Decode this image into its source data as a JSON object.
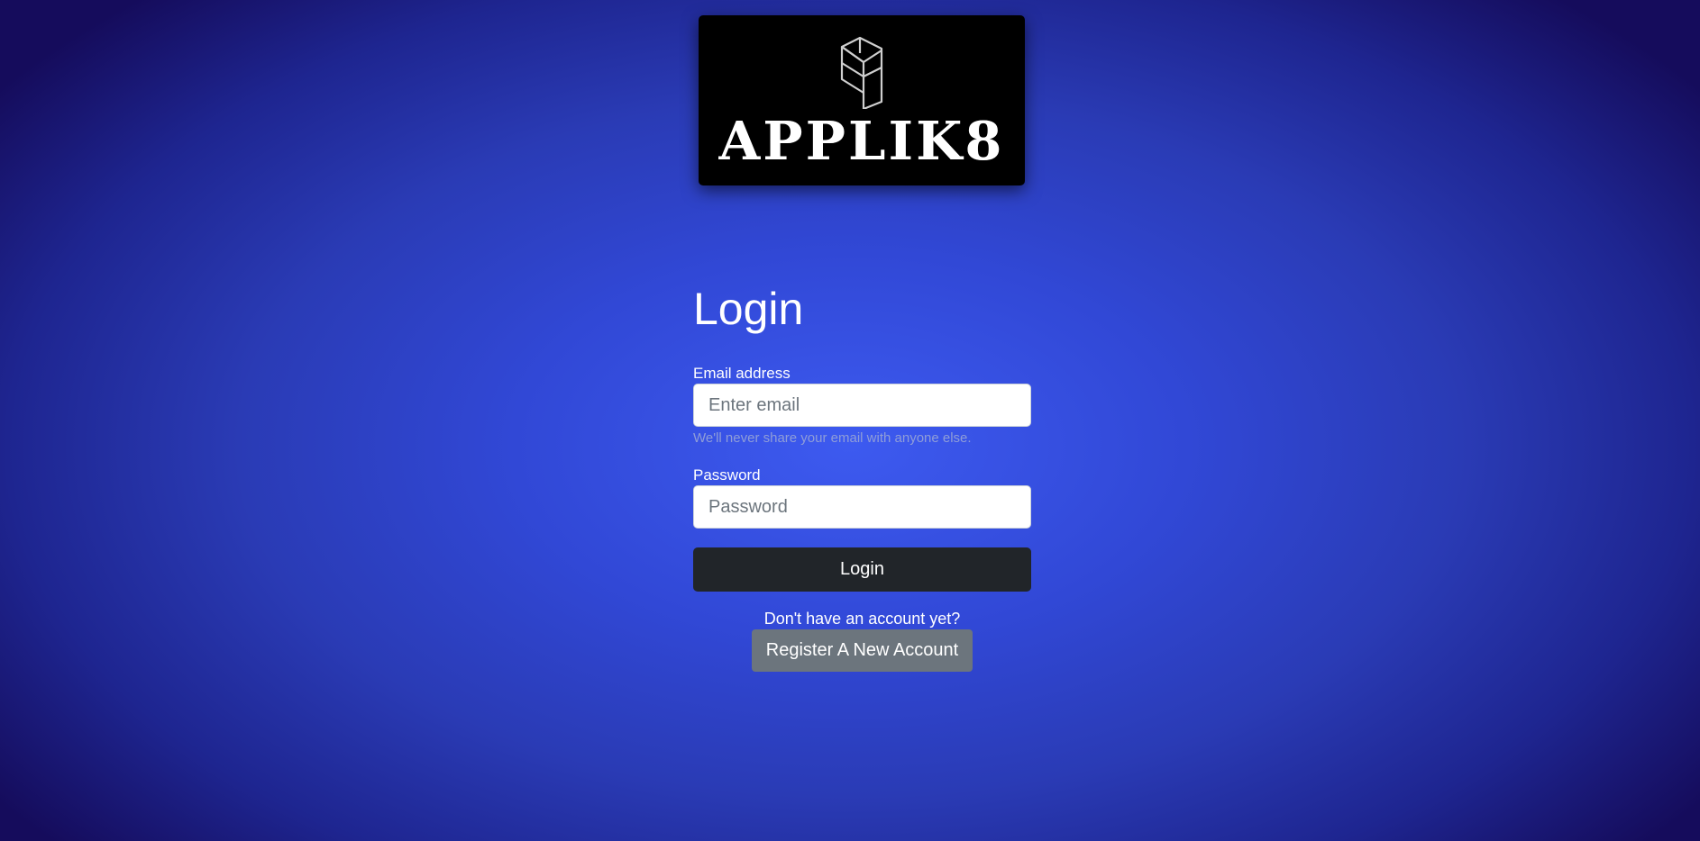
{
  "logo": {
    "text": "APPLIK8",
    "icon": "isometric-door-logo-icon"
  },
  "login": {
    "title": "Login",
    "email_label": "Email address",
    "email_placeholder": "Enter email",
    "email_value": "",
    "email_help": "We'll never share your email with anyone else.",
    "password_label": "Password",
    "password_placeholder": "Password",
    "password_value": "",
    "submit_label": "Login"
  },
  "register": {
    "prompt": "Don't have an account yet?",
    "button_label": "Register A New Account"
  },
  "colors": {
    "background_center": "#3d5af0",
    "background_edge": "#150c5c",
    "login_button": "#212529",
    "register_button": "#6c757d",
    "help_text": "#8f9dd8"
  }
}
